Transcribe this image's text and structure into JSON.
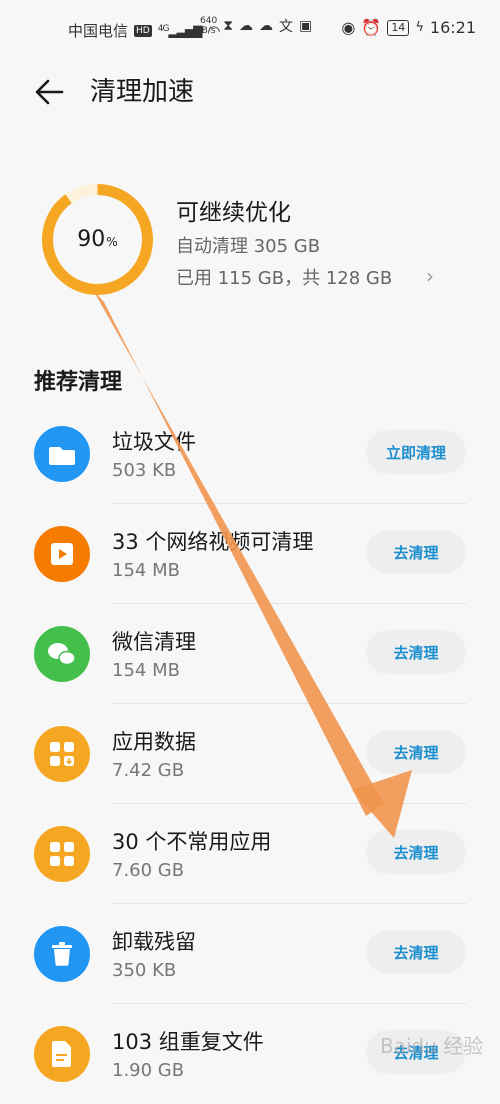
{
  "status": {
    "carrier": "中国电信",
    "hd": "HD",
    "network": "4G",
    "speed_value": "640",
    "speed_unit": "B/s",
    "battery": "14",
    "time": "16:21"
  },
  "header": {
    "title": "清理加速"
  },
  "summary": {
    "percent": "90",
    "percent_sign": "%",
    "title": "可继续优化",
    "auto_clean": "自动清理 305 GB",
    "used": "已用 115 GB，共 128 GB"
  },
  "section": {
    "title": "推荐清理"
  },
  "items": [
    {
      "name": "垃圾文件",
      "size": "503 KB",
      "button": "立即清理",
      "icon": "folder-icon",
      "color": "#2196f3"
    },
    {
      "name": "33 个网络视频可清理",
      "size": "154 MB",
      "button": "去清理",
      "icon": "video-icon",
      "color": "#f57c00"
    },
    {
      "name": "微信清理",
      "size": "154 MB",
      "button": "去清理",
      "icon": "wechat-icon",
      "color": "#43c04b"
    },
    {
      "name": "应用数据",
      "size": "7.42 GB",
      "button": "去清理",
      "icon": "app-data-icon",
      "color": "#f5a623"
    },
    {
      "name": "30 个不常用应用",
      "size": "7.60 GB",
      "button": "去清理",
      "icon": "apps-grid-icon",
      "color": "#f5a623"
    },
    {
      "name": "卸载残留",
      "size": "350 KB",
      "button": "去清理",
      "icon": "trash-icon",
      "color": "#2196f3"
    },
    {
      "name": "103 组重复文件",
      "size": "1.90 GB",
      "button": "去清理",
      "icon": "duplicate-file-icon",
      "color": "#f5a623"
    }
  ],
  "watermark": "Baidu 经验",
  "colors": {
    "ring": "#f5a623",
    "ring_track": "#fdf1dc",
    "accent_text": "#1a8fcf",
    "arrow": "#f0944d"
  }
}
